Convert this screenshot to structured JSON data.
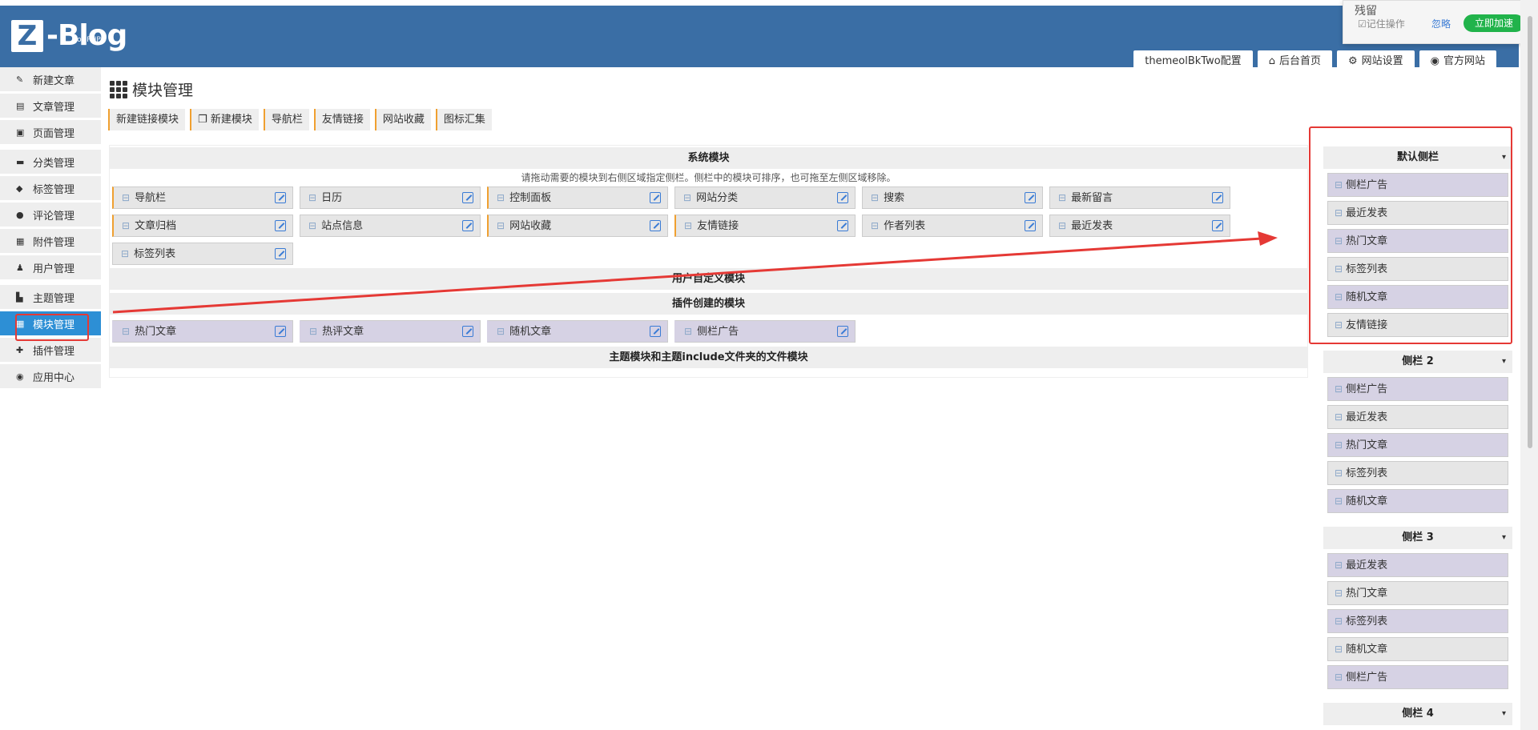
{
  "logo": {
    "mark": "Z",
    "name": "-Blog",
    "sub": "for PHP"
  },
  "top_tabs": [
    {
      "label": "themeolBkTwo配置",
      "icon": ""
    },
    {
      "label": "后台首页",
      "icon": "home-icon"
    },
    {
      "label": "网站设置",
      "icon": "gear-icon"
    },
    {
      "label": "官方网站",
      "icon": "globe-icon"
    }
  ],
  "popup": {
    "title": "残留",
    "remember": "☑记住操作",
    "ignore": "忽略",
    "accelerate": "立即加速"
  },
  "sidebar": [
    {
      "label": "新建文章",
      "icon": "✎"
    },
    {
      "label": "文章管理",
      "icon": "▤"
    },
    {
      "label": "页面管理",
      "icon": "▣"
    },
    {
      "label": "分类管理",
      "icon": "▬"
    },
    {
      "label": "标签管理",
      "icon": "◆"
    },
    {
      "label": "评论管理",
      "icon": "●"
    },
    {
      "label": "附件管理",
      "icon": "▦"
    },
    {
      "label": "用户管理",
      "icon": "♟"
    },
    {
      "label": "主题管理",
      "icon": "▙"
    },
    {
      "label": "模块管理",
      "icon": "▦",
      "active": true
    },
    {
      "label": "插件管理",
      "icon": "✚"
    },
    {
      "label": "应用中心",
      "icon": "◉"
    }
  ],
  "page": {
    "title": "模块管理"
  },
  "toolbar": [
    "新建链接模块",
    "新建模块",
    "导航栏",
    "友情链接",
    "网站收藏",
    "图标汇集"
  ],
  "sections": {
    "system": "系统模块",
    "hint": "请拖动需要的模块到右侧区域指定侧栏。侧栏中的模块可排序，也可拖至左侧区域移除。",
    "user": "用户自定义模块",
    "plugin": "插件创建的模块",
    "theme": "主题模块和主题include文件夹的文件模块"
  },
  "system_modules": [
    [
      "导航栏",
      "日历",
      "控制面板",
      "网站分类",
      "搜索",
      "最新留言"
    ],
    [
      "文章归档",
      "站点信息",
      "网站收藏",
      "友情链接",
      "作者列表",
      "最近发表"
    ],
    [
      "标签列表"
    ]
  ],
  "plugin_modules": [
    "热门文章",
    "热评文章",
    "随机文章",
    "侧栏广告"
  ],
  "sidebars": [
    {
      "name": "默认侧栏",
      "items": [
        "侧栏广告",
        "最近发表",
        "热门文章",
        "标签列表",
        "随机文章",
        "友情链接"
      ]
    },
    {
      "name": "侧栏 2",
      "items": [
        "侧栏广告",
        "最近发表",
        "热门文章",
        "标签列表",
        "随机文章"
      ]
    },
    {
      "name": "侧栏 3",
      "items": [
        "最近发表",
        "热门文章",
        "标签列表",
        "随机文章",
        "侧栏广告"
      ]
    },
    {
      "name": "侧栏 4",
      "items": []
    }
  ],
  "colors": {
    "header": "#3a6ea5",
    "active": "#2d8fd5",
    "accent": "#f0a030",
    "module_purple": "#d6d2e4",
    "annotation": "#e53935"
  }
}
